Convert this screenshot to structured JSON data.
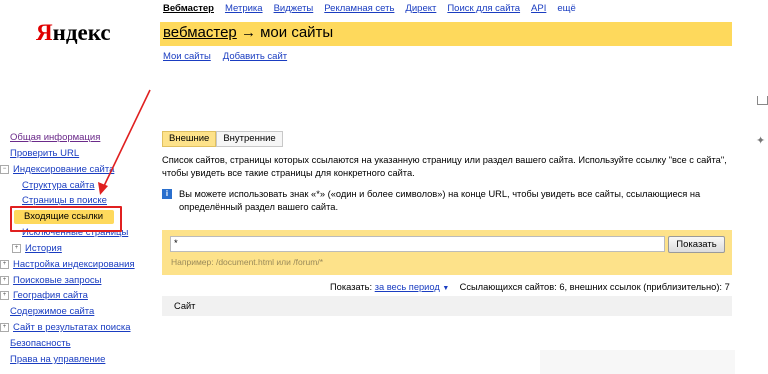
{
  "logo": {
    "first": "Я",
    "rest": "ндекс"
  },
  "topnav": {
    "items": [
      "Вебмастер",
      "Метрика",
      "Виджеты",
      "Рекламная сеть",
      "Директ",
      "Поиск для сайта",
      "API",
      "ещё"
    ]
  },
  "header": {
    "title_link": "вебмастер",
    "title_rest": " → мои сайты"
  },
  "subnav": {
    "items": [
      "Мои сайты",
      "Добавить сайт"
    ]
  },
  "sidebar": {
    "items": [
      "Общая информация",
      "Проверить URL",
      "Индексирование сайта",
      "Структура сайта",
      "Страницы в поиске",
      "Входящие ссылки",
      "Исключенные страницы",
      "История",
      "Настройка индексирования",
      "Поисковые запросы",
      "География сайта",
      "Содержимое сайта",
      "Сайт в результатах поиска",
      "Безопасность",
      "Права на управление"
    ],
    "expander_minus": "−",
    "expander_plus": "+"
  },
  "tabs": {
    "external": "Внешние",
    "internal": "Внутренние"
  },
  "description": "Список сайтов, страницы которых ссылаются на указанную страницу или раздел вашего сайта. Используйте ссылку \"все с сайта\", чтобы увидеть все такие страницы для конкретного сайта.",
  "info": {
    "icon": "i",
    "text": "Вы можете использовать знак «*» («один и более символов») на конце URL, чтобы увидеть все сайты, ссылающиеся на определённый раздел вашего сайта."
  },
  "search": {
    "value": "*",
    "button": "Показать",
    "hint": "Например: /document.html или /forum/*"
  },
  "stats": {
    "show_label": "Показать: ",
    "period": "за весь период",
    "period_arrow": "▼",
    "summary": "Ссылающихся сайтов: 6, внешних ссылок (приблизительно): 7"
  },
  "table": {
    "column_site": "Сайт"
  },
  "right_icons": {
    "icon2": "✦"
  }
}
